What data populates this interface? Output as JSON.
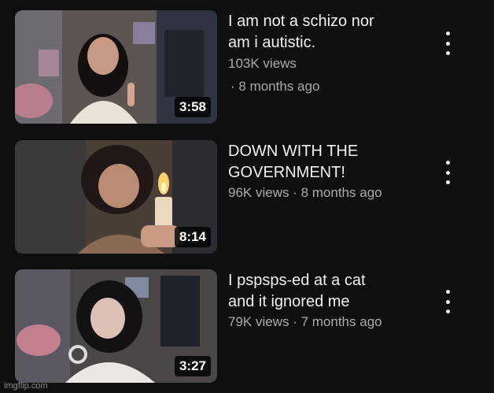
{
  "videos": [
    {
      "title": "I am not a schizo nor\nam i autistic.",
      "views": "103K views",
      "age": "· 8 months ago",
      "duration": "3:58"
    },
    {
      "title": "DOWN WITH THE\nGOVERNMENT!",
      "views": "96K views · 8 months ago",
      "duration": "8:14"
    },
    {
      "title": "I pspsps-ed at a cat\nand it ignored me",
      "views": "79K views · 7 months ago",
      "duration": "3:27"
    }
  ],
  "watermark": "imgflip.com",
  "colors": {
    "background": "#0f0f0f",
    "title": "#f1f1f1",
    "meta": "#aaaaaa"
  },
  "icons": {
    "more": "vertical-ellipsis-icon"
  }
}
